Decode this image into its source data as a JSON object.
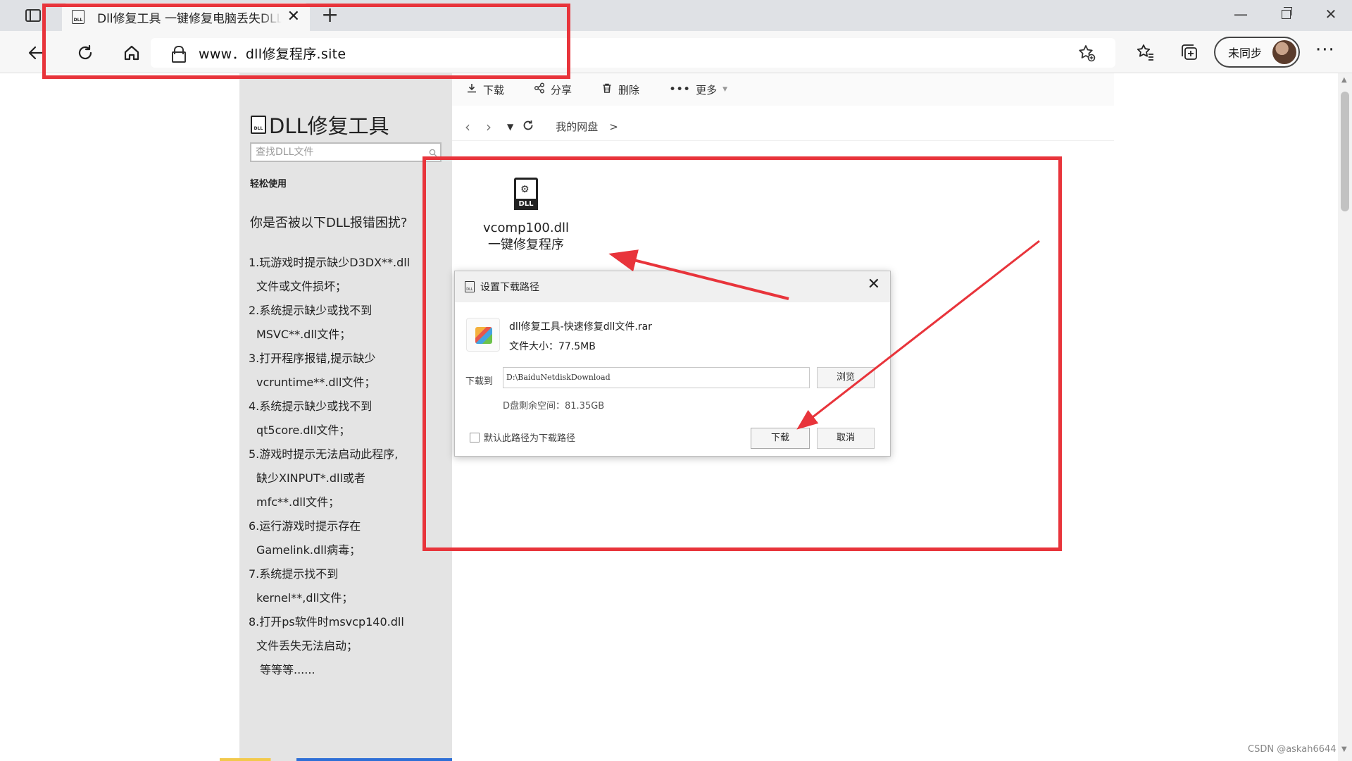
{
  "browser": {
    "tab_title": "Dll修复工具 一键修复电脑丢失DLL",
    "tab_close": "✕",
    "new_tab": "+",
    "url": "www．dll修复程序.site",
    "profile_label": "未同步",
    "window_controls": {
      "minimize": "—",
      "close": "✕"
    },
    "icons": {
      "back": "arrow-left-icon",
      "refresh": "refresh-icon",
      "home": "home-icon",
      "lock": "lock-icon",
      "favorite_add": "star-plus-icon",
      "favorites": "star-list-icon",
      "collections": "collections-icon",
      "more": "ellipsis-icon"
    }
  },
  "sidebar": {
    "logo_text": "DLL修复工具",
    "search_placeholder": "查找DLL文件",
    "section_label": "轻松使用",
    "question": "你是否被以下DLL报错困扰?",
    "errors": [
      "1.玩游戏时提示缺少D3DX**.dll",
      "文件或文件损坏；",
      "2.系统提示缺少或找不到",
      "MSVC**.dll文件；",
      "3.打开程序报错,提示缺少",
      "vcruntime**.dll文件；",
      "4.系统提示缺少或找不到",
      "qt5core.dll文件；",
      "5.游戏时提示无法启动此程序,",
      "缺少XINPUT*.dll或者",
      "mfc**.dll文件；",
      "6.运行游戏时提示存在",
      "Gamelink.dll病毒；",
      "7.系统提示找不到",
      "kernel**,dll文件；",
      "8.打开ps软件时msvcp140.dll",
      "文件丢失无法启动；",
      "等等等......"
    ]
  },
  "netdisk": {
    "toolbar": {
      "download": "下载",
      "share": "分享",
      "delete": "删除",
      "more": "更多"
    },
    "breadcrumb": "我的网盘",
    "breadcrumb_arrow": ">",
    "file": {
      "name_line1": "vcomp100.dll",
      "name_line2": "一键修复程序",
      "icon_tag": "DLL"
    }
  },
  "dialog": {
    "title": "设置下载路径",
    "file_name": "dll修复工具-快速修复dll文件.rar",
    "file_size": "文件大小：77.5MB",
    "path_label": "下载到",
    "path_value": "D:\\BaiduNetdiskDownload",
    "browse": "浏览",
    "free_space": "D盘剩余空间：81.35GB",
    "default_path_label": "默认此路径为下载路径",
    "download": "下载",
    "cancel": "取消"
  },
  "annotations": {
    "highlight_color": "#e8343b"
  },
  "watermark": "CSDN @askah6644"
}
